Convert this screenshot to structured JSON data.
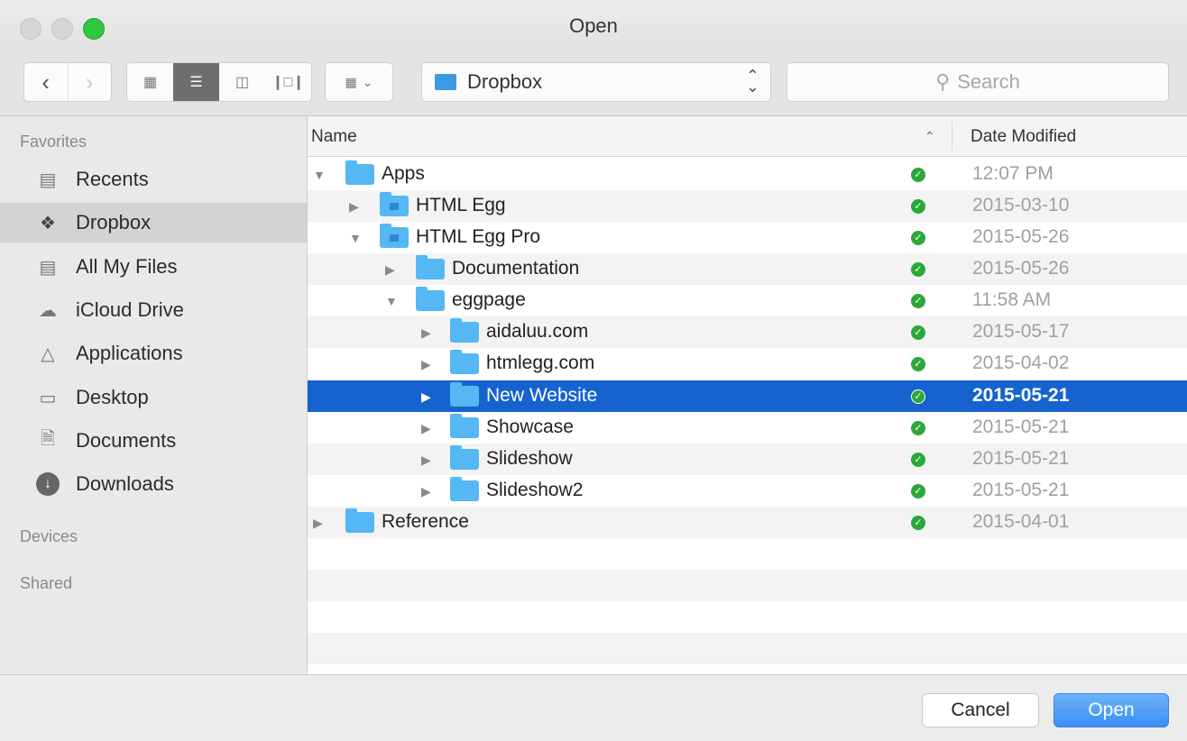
{
  "window": {
    "title": "Open"
  },
  "toolbar": {
    "back_icon": "chevron-left",
    "forward_icon": "chevron-right",
    "view_modes": [
      "icon",
      "list",
      "column",
      "cover-flow"
    ],
    "selected_view": "list",
    "arrange_icon": "arrange-grid",
    "path_label": "Dropbox",
    "search_placeholder": "Search"
  },
  "sidebar": {
    "favorites_label": "Favorites",
    "devices_label": "Devices",
    "shared_label": "Shared",
    "items": [
      {
        "label": "Recents",
        "icon": "recents-icon"
      },
      {
        "label": "Dropbox",
        "icon": "dropbox-icon"
      },
      {
        "label": "All My Files",
        "icon": "all-files-icon"
      },
      {
        "label": "iCloud Drive",
        "icon": "cloud-icon"
      },
      {
        "label": "Applications",
        "icon": "applications-icon"
      },
      {
        "label": "Desktop",
        "icon": "desktop-icon"
      },
      {
        "label": "Documents",
        "icon": "documents-icon"
      },
      {
        "label": "Downloads",
        "icon": "downloads-icon"
      }
    ],
    "selected": "Dropbox"
  },
  "list": {
    "col_name": "Name",
    "col_date": "Date Modified",
    "sort_indicator": "^",
    "rows": [
      {
        "name": "Apps",
        "date": "12:07 PM",
        "depth": 0,
        "expanded": true
      },
      {
        "name": "HTML Egg",
        "date": "2015-03-10",
        "depth": 1,
        "expanded": false,
        "dropbox": true
      },
      {
        "name": "HTML Egg Pro",
        "date": "2015-05-26",
        "depth": 1,
        "expanded": true,
        "dropbox": true
      },
      {
        "name": "Documentation",
        "date": "2015-05-26",
        "depth": 2,
        "expanded": false
      },
      {
        "name": "eggpage",
        "date": "11:58 AM",
        "depth": 2,
        "expanded": true
      },
      {
        "name": "aidaluu.com",
        "date": "2015-05-17",
        "depth": 3,
        "expanded": false
      },
      {
        "name": "htmlegg.com",
        "date": "2015-04-02",
        "depth": 3,
        "expanded": false
      },
      {
        "name": "New Website",
        "date": "2015-05-21",
        "depth": 3,
        "expanded": false,
        "selected": true
      },
      {
        "name": "Showcase",
        "date": "2015-05-21",
        "depth": 3,
        "expanded": false
      },
      {
        "name": "Slideshow",
        "date": "2015-05-21",
        "depth": 3,
        "expanded": false
      },
      {
        "name": "Slideshow2",
        "date": "2015-05-21",
        "depth": 3,
        "expanded": false
      },
      {
        "name": "Reference",
        "date": "2015-04-01",
        "depth": 0,
        "expanded": false
      }
    ]
  },
  "buttons": {
    "cancel": "Cancel",
    "open": "Open"
  },
  "colors": {
    "selection": "#1663d0",
    "sync_ok": "#2aa83a",
    "folder": "#55b7f3",
    "primary_button": "#3b8ff4"
  }
}
